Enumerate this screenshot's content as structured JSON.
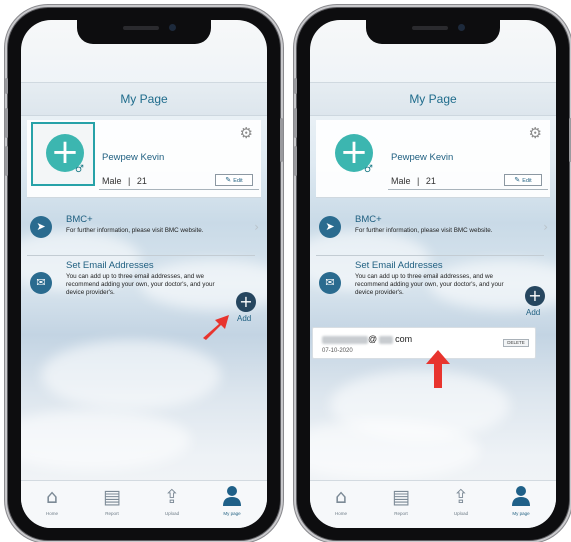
{
  "page": {
    "title": "My Page"
  },
  "profile": {
    "name": "Pewpew Kevin",
    "gender": "Male",
    "separator": "|",
    "age": "21",
    "edit_label": "Edit",
    "avatar_plus": "+"
  },
  "menu": {
    "bmc": {
      "title": "BMC+",
      "desc": "For further information, please visit BMC website."
    },
    "email": {
      "title": "Set Email Addresses",
      "desc": "You can add up to three email addresses, and we recommend adding your own, your doctor's, and your device provider's.",
      "add_label": "Add",
      "add_symbol": "+"
    }
  },
  "email_entry": {
    "at": "@",
    "domain_suffix": "com",
    "date": "07-10-2020",
    "delete_label": "DELETE"
  },
  "tabs": [
    {
      "label": "Home",
      "icon": "home-icon",
      "active": false
    },
    {
      "label": "Report",
      "icon": "report-icon",
      "active": false
    },
    {
      "label": "Upload",
      "icon": "upload-icon",
      "active": false
    },
    {
      "label": "My page",
      "icon": "person-icon",
      "active": true
    }
  ],
  "colors": {
    "accent_teal": "#3cb6b0",
    "title_blue": "#1f6c8c",
    "arrow_red": "#e8342e",
    "icon_navy": "#2a6b8f"
  }
}
